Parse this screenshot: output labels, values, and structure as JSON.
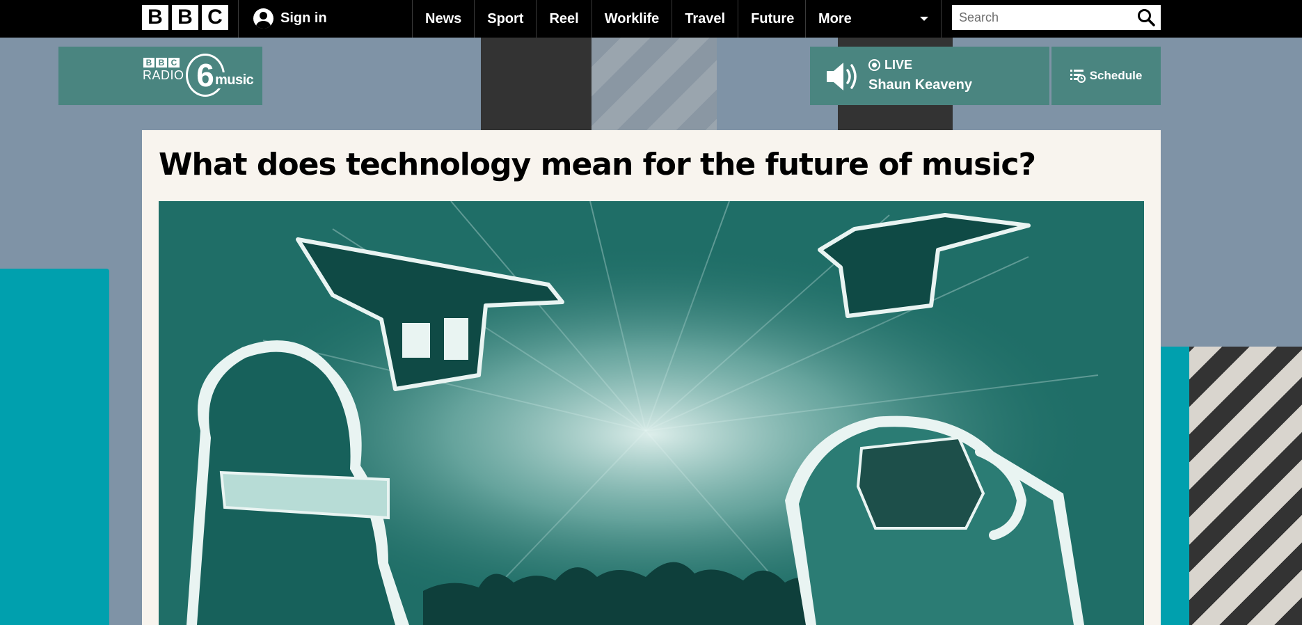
{
  "nav": {
    "logo_letters": [
      "B",
      "B",
      "C"
    ],
    "sign_in": "Sign in",
    "links": [
      "News",
      "Sport",
      "Reel",
      "Worklife",
      "Travel",
      "Future"
    ],
    "more": "More",
    "search_placeholder": "Search"
  },
  "station": {
    "logo_bbc": [
      "B",
      "B",
      "C"
    ],
    "logo_radio": "RADIO",
    "logo_number": "6",
    "logo_music": "music",
    "live_label": "LIVE",
    "presenter": "Shaun Keaveny",
    "schedule": "Schedule"
  },
  "article": {
    "headline": "What does technology mean for the future of music?"
  },
  "colors": {
    "nav_bg": "#000000",
    "page_bg": "#7f93a6",
    "station_teal": "#4a8580",
    "accent_cyan": "#00a0ae",
    "card_bg": "#f8f4ee",
    "hero_teal": "#1f6e67"
  }
}
